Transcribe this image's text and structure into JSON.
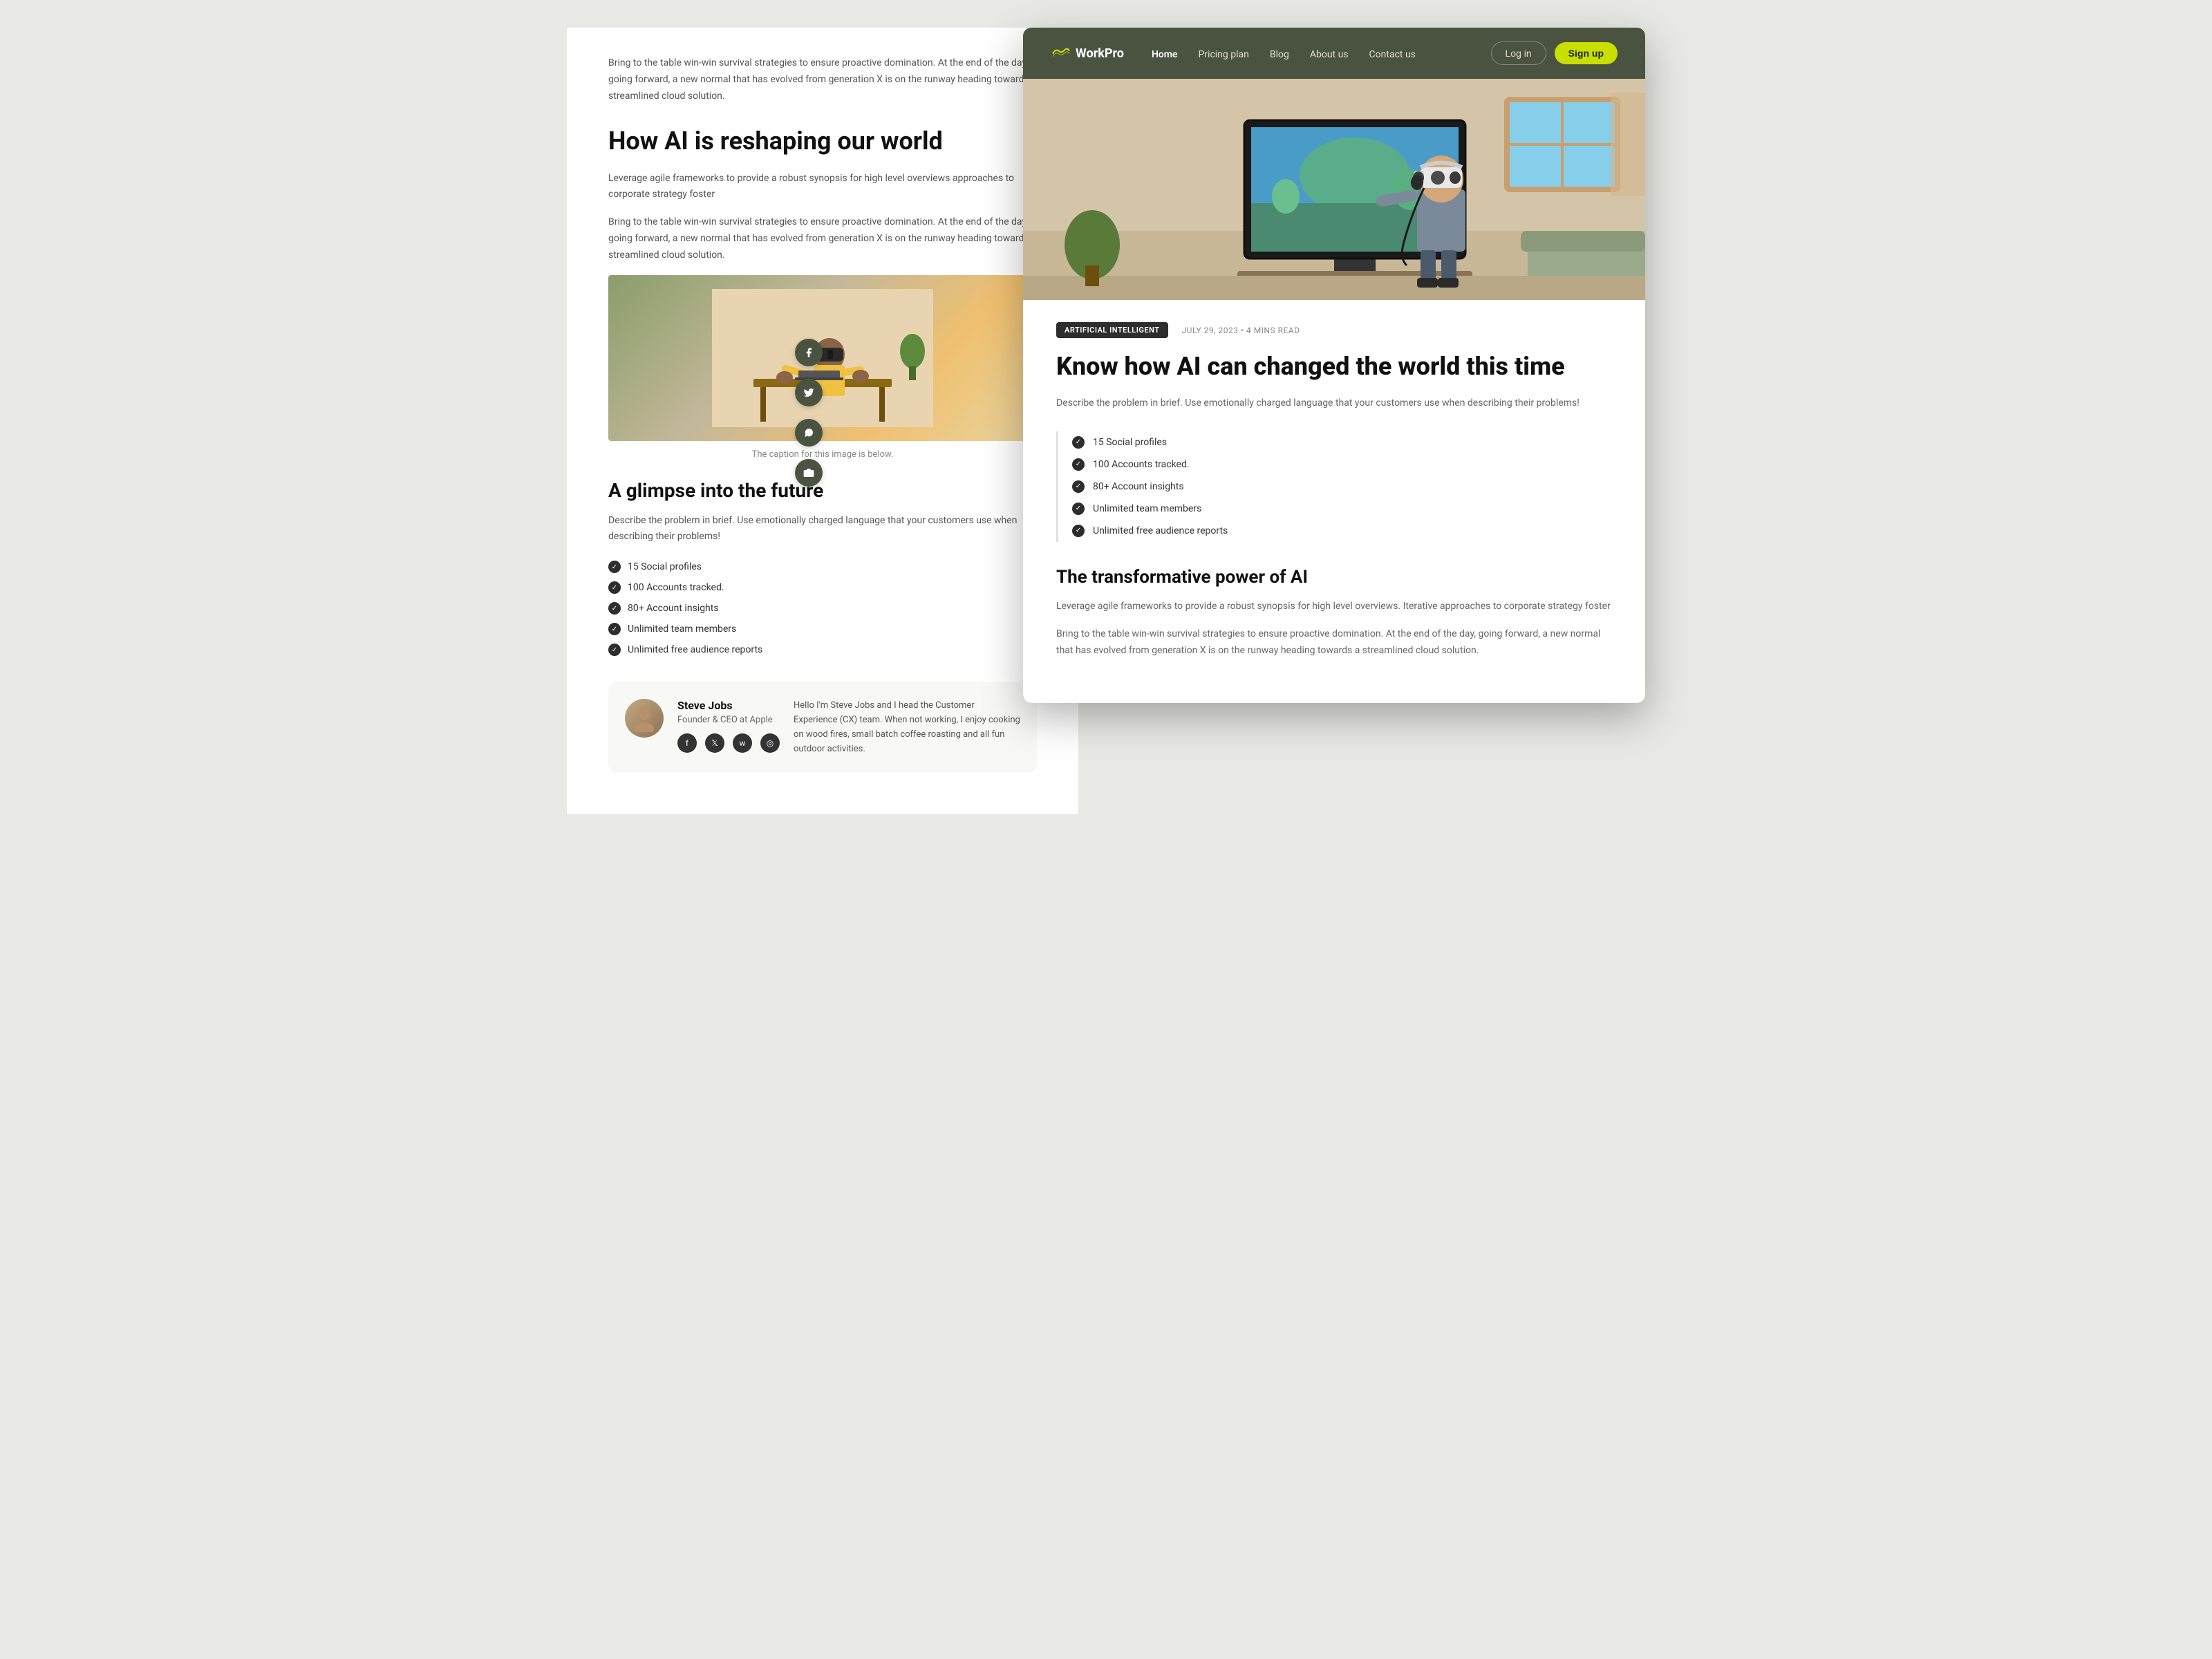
{
  "backPanel": {
    "introText": "Bring to the table win-win survival strategies to ensure proactive domination. At the end of the day, going forward, a new normal that has evolved from generation X is on the runway heading towards a streamlined cloud solution.",
    "heading1": "How AI is reshaping our world",
    "bodyText1": "Leverage agile frameworks to provide a robust synopsis for high level overviews approaches to corporate strategy foster",
    "bodyText2": "Bring to the table win-win survival strategies to ensure proactive domination. At the end of the day, going forward, a new normal that has evolved from generation X is on the runway heading towards a streamlined cloud solution.",
    "imageCaption": "The caption for this image is below.",
    "heading2": "A glimpse into the future",
    "bodyText3": "Describe the problem in brief. Use emotionally charged language that your customers use when describing their problems!",
    "checklist": [
      "15 Social profiles",
      "100 Accounts tracked.",
      "80+ Account insights",
      "Unlimited team members",
      "Unlimited free audience reports"
    ],
    "author": {
      "name": "Steve Jobs",
      "role": "Founder & CEO at Apple",
      "bio": "Hello I'm Steve Jobs and I head the Customer Experience (CX) team. When not working, I enjoy cooking on wood fires, small batch coffee roasting and all fun outdoor activities.",
      "socials": [
        "f",
        "t",
        "w",
        "c"
      ]
    }
  },
  "navbar": {
    "logoText": "WorkPro",
    "links": [
      {
        "label": "Home",
        "active": true
      },
      {
        "label": "Pricing plan",
        "active": false
      },
      {
        "label": "Blog",
        "active": false
      },
      {
        "label": "About us",
        "active": false
      },
      {
        "label": "Contact us",
        "active": false
      }
    ],
    "loginLabel": "Log in",
    "signupLabel": "Sign up"
  },
  "article": {
    "tag": "ARTIFICIAL INTELLIGENT",
    "date": "JULY 29, 2023",
    "readTime": "4 MINS READ",
    "title": "Know how AI can changed the world this time",
    "description": "Describe the problem in brief. Use emotionally charged language that your customers use when describing their problems!",
    "checklist": [
      "15 Social profiles",
      "100 Accounts tracked.",
      "80+ Account insights",
      "Unlimited team members",
      "Unlimited free audience reports"
    ],
    "sectionTitle": "The transformative power of AI",
    "bodyText1": "Leverage agile frameworks to provide a robust synopsis for high level overviews. Iterative approaches to corporate strategy foster",
    "bodyText2": "Bring to the table win-win survival strategies to ensure proactive domination. At the end of the day, going forward, a new normal that has evolved from generation X is on the runway heading towards a streamlined cloud solution."
  },
  "socialShare": {
    "icons": [
      "facebook",
      "twitter",
      "whatsapp",
      "camera"
    ]
  },
  "colors": {
    "navBg": "#4a5240",
    "accent": "#c8e000",
    "checkBg": "#2d2d2d"
  }
}
